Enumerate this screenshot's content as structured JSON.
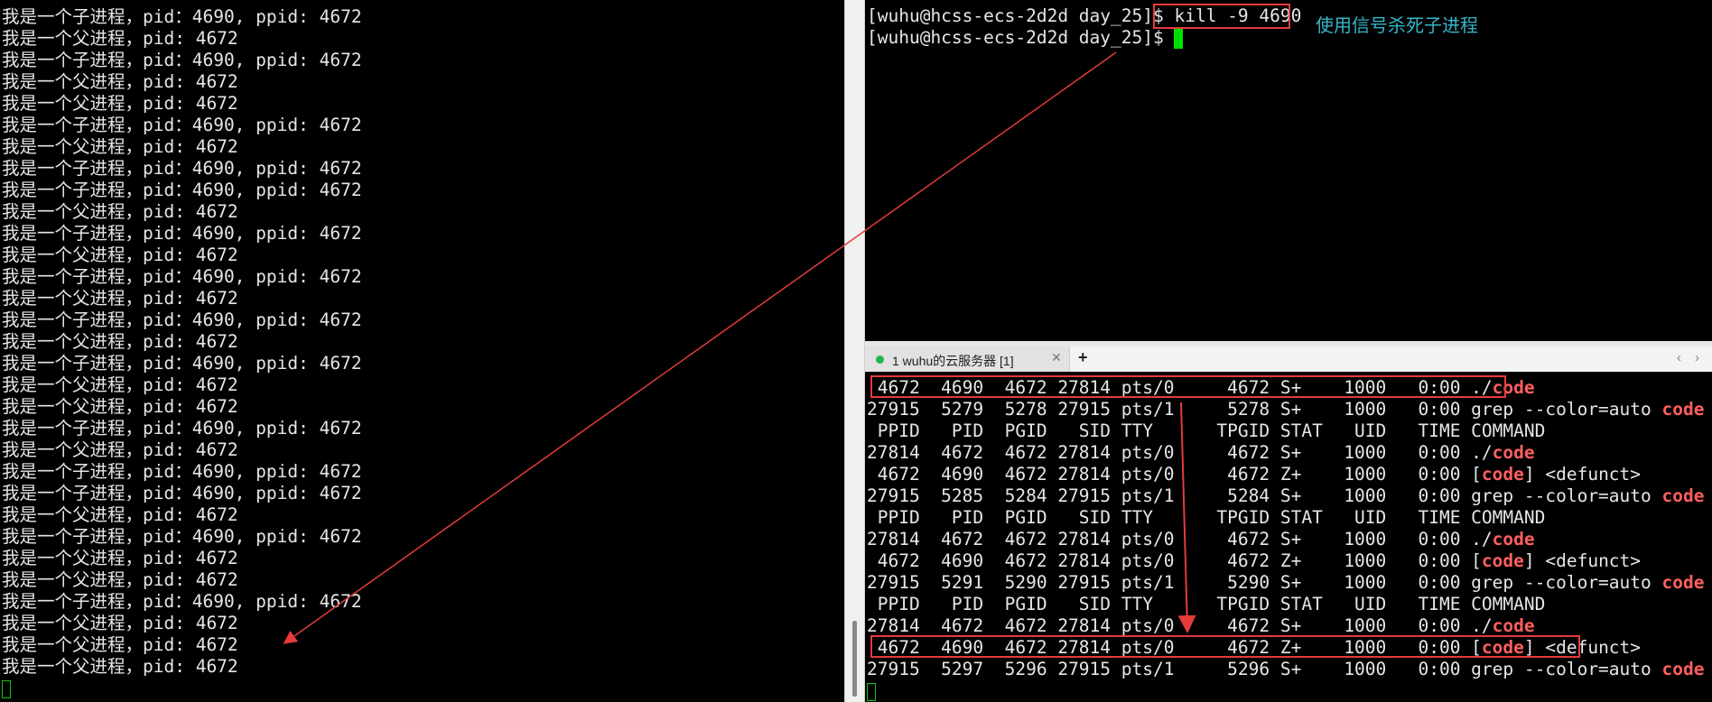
{
  "left_terminal": {
    "lines": [
      "我是一个子进程，pid：4690, ppid: 4672",
      "我是一个父进程，pid: 4672",
      "我是一个子进程，pid：4690, ppid: 4672",
      "我是一个父进程，pid: 4672",
      "我是一个父进程，pid: 4672",
      "我是一个子进程，pid：4690, ppid: 4672",
      "我是一个父进程，pid: 4672",
      "我是一个子进程，pid：4690, ppid: 4672",
      "我是一个子进程，pid：4690, ppid: 4672",
      "我是一个父进程，pid: 4672",
      "我是一个子进程，pid：4690, ppid: 4672",
      "我是一个父进程，pid: 4672",
      "我是一个子进程，pid：4690, ppid: 4672",
      "我是一个父进程，pid: 4672",
      "我是一个子进程，pid：4690, ppid: 4672",
      "我是一个父进程，pid: 4672",
      "我是一个子进程，pid：4690, ppid: 4672",
      "我是一个父进程，pid: 4672",
      "我是一个父进程，pid: 4672",
      "我是一个子进程，pid：4690, ppid: 4672",
      "我是一个父进程，pid: 4672",
      "我是一个子进程，pid：4690, ppid: 4672",
      "我是一个子进程，pid：4690, ppid: 4672",
      "我是一个父进程，pid: 4672",
      "我是一个子进程，pid：4690, ppid: 4672",
      "我是一个父进程，pid: 4672",
      "我是一个父进程，pid: 4672",
      "我是一个子进程，pid：4690, ppid: 4672",
      "我是一个父进程，pid: 4672",
      "我是一个父进程，pid: 4672",
      "我是一个父进程，pid: 4672"
    ]
  },
  "top_right_terminal": {
    "prompt": "[wuhu@hcss-ecs-2d2d day_25]$ ",
    "command": "kill -9 4690",
    "annotation": "使用信号杀死子进程"
  },
  "tab_bar": {
    "tab_label": "1 wuhu的云服务器 [1]",
    "close_glyph": "✕",
    "add_glyph": "+",
    "prev_glyph": "‹",
    "next_glyph": "›"
  },
  "bottom_terminal": {
    "highlight_word": "code",
    "rows": [
      {
        "pre": " 4672  4690  4672 27814 pts/0     4672 S+    1000   0:00 ./",
        "hl": "code",
        "post": ""
      },
      {
        "pre": "27915  5279  5278 27915 pts/1     5278 S+    1000   0:00 grep --color=auto ",
        "hl": "code",
        "post": ""
      },
      {
        "pre": " PPID   PID  PGID   SID TTY      TPGID STAT   UID   TIME COMMAND",
        "hl": "",
        "post": ""
      },
      {
        "pre": "27814  4672  4672 27814 pts/0     4672 S+    1000   0:00 ./",
        "hl": "code",
        "post": ""
      },
      {
        "pre": " 4672  4690  4672 27814 pts/0     4672 Z+    1000   0:00 [",
        "hl": "code",
        "post": "] <defunct>"
      },
      {
        "pre": "27915  5285  5284 27915 pts/1     5284 S+    1000   0:00 grep --color=auto ",
        "hl": "code",
        "post": ""
      },
      {
        "pre": " PPID   PID  PGID   SID TTY      TPGID STAT   UID   TIME COMMAND",
        "hl": "",
        "post": ""
      },
      {
        "pre": "27814  4672  4672 27814 pts/0     4672 S+    1000   0:00 ./",
        "hl": "code",
        "post": ""
      },
      {
        "pre": " 4672  4690  4672 27814 pts/0     4672 Z+    1000   0:00 [",
        "hl": "code",
        "post": "] <defunct>"
      },
      {
        "pre": "27915  5291  5290 27915 pts/1     5290 S+    1000   0:00 grep --color=auto ",
        "hl": "code",
        "post": ""
      },
      {
        "pre": " PPID   PID  PGID   SID TTY      TPGID STAT   UID   TIME COMMAND",
        "hl": "",
        "post": ""
      },
      {
        "pre": "27814  4672  4672 27814 pts/0     4672 S+    1000   0:00 ./",
        "hl": "code",
        "post": ""
      },
      {
        "pre": " 4672  4690  4672 27814 pts/0     4672 Z+    1000   0:00 [",
        "hl": "code",
        "post": "] <defunct>"
      },
      {
        "pre": "27915  5297  5296 27915 pts/1     5296 S+    1000   0:00 grep --color=auto ",
        "hl": "code",
        "post": ""
      }
    ]
  },
  "colors": {
    "terminal_bg": "#000000",
    "terminal_fg": "#e6e6e6",
    "highlight": "#ff5f5f",
    "annotation_red": "#e53b3b",
    "annotation_text": "#35b6c8",
    "cursor_green": "#00e000",
    "tab_dot": "#27b24a"
  }
}
